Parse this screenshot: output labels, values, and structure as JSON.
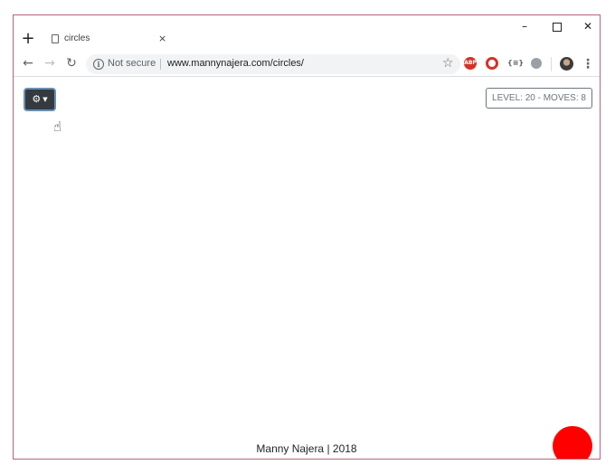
{
  "browser": {
    "tab_title": "circles",
    "tab_close": "×",
    "new_tab": "+",
    "window_controls": {
      "minimize": "–",
      "close": "✕"
    },
    "security_label": "Not secure",
    "url": "www.mannynajera.com/circles/",
    "extensions": {
      "abp": "ABP",
      "json": "{≡}"
    },
    "icons": [
      "back-arrow-icon",
      "forward-arrow-icon",
      "reload-icon",
      "info-icon",
      "star-icon",
      "menu-dots-icon"
    ]
  },
  "game": {
    "status_text": "LEVEL: 20  -  MOVES: 8",
    "footer_text": "Manny Najera | 2018",
    "circle_color": "#ff0000",
    "settings_button_bg": "#343a40"
  }
}
